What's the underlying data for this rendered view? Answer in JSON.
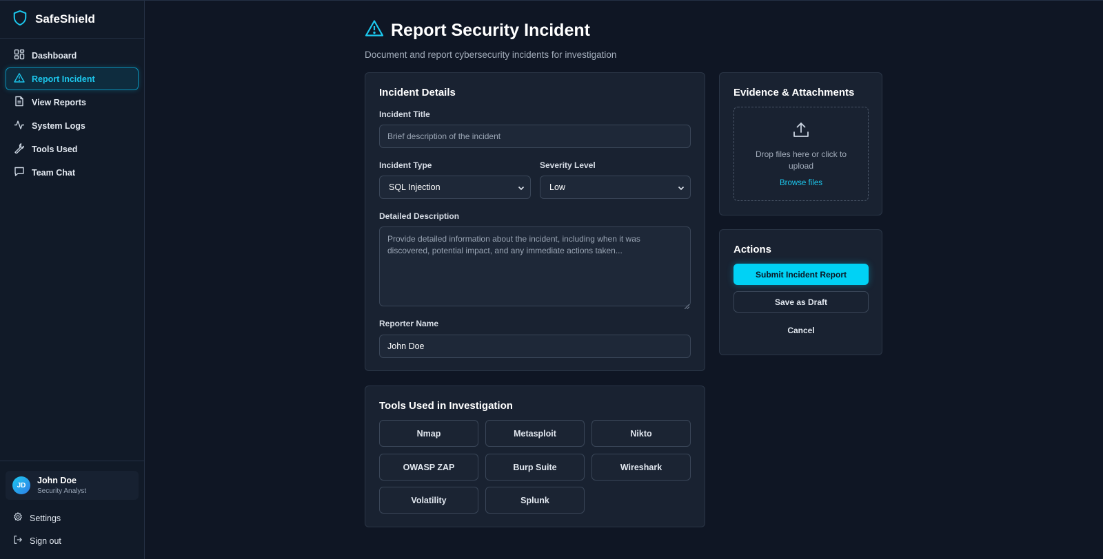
{
  "brand": {
    "name": "SafeShield",
    "accent": "#1cc8ee"
  },
  "sidebar": {
    "items": [
      {
        "label": "Dashboard",
        "icon": "dashboard-icon"
      },
      {
        "label": "Report Incident",
        "icon": "alert-triangle-icon",
        "active": true
      },
      {
        "label": "View Reports",
        "icon": "document-icon"
      },
      {
        "label": "System Logs",
        "icon": "activity-icon"
      },
      {
        "label": "Tools Used",
        "icon": "wrench-icon"
      },
      {
        "label": "Team Chat",
        "icon": "chat-icon"
      }
    ],
    "user": {
      "initials": "JD",
      "name": "John Doe",
      "role": "Security Analyst"
    },
    "settings_label": "Settings",
    "signout_label": "Sign out"
  },
  "header": {
    "title": "Report Security Incident",
    "subtitle": "Document and report cybersecurity incidents for investigation"
  },
  "incident_details": {
    "title": "Incident Details",
    "incident_title_label": "Incident Title",
    "incident_title_placeholder": "Brief description of the incident",
    "incident_title_value": "",
    "type_label": "Incident Type",
    "type_value": "SQL Injection",
    "severity_label": "Severity Level",
    "severity_value": "Low",
    "description_label": "Detailed Description",
    "description_placeholder": "Provide detailed information about the incident, including when it was discovered, potential impact, and any immediate actions taken...",
    "reporter_label": "Reporter Name",
    "reporter_value": "John Doe"
  },
  "tools": {
    "title": "Tools Used in Investigation",
    "items": [
      "Nmap",
      "Metasploit",
      "Nikto",
      "OWASP ZAP",
      "Burp Suite",
      "Wireshark",
      "Volatility",
      "Splunk"
    ]
  },
  "evidence": {
    "title": "Evidence & Attachments",
    "drop_text": "Drop files here or click to upload",
    "browse_label": "Browse files",
    "icon": "upload-icon"
  },
  "actions": {
    "title": "Actions",
    "submit_label": "Submit Incident Report",
    "draft_label": "Save as Draft",
    "cancel_label": "Cancel"
  }
}
